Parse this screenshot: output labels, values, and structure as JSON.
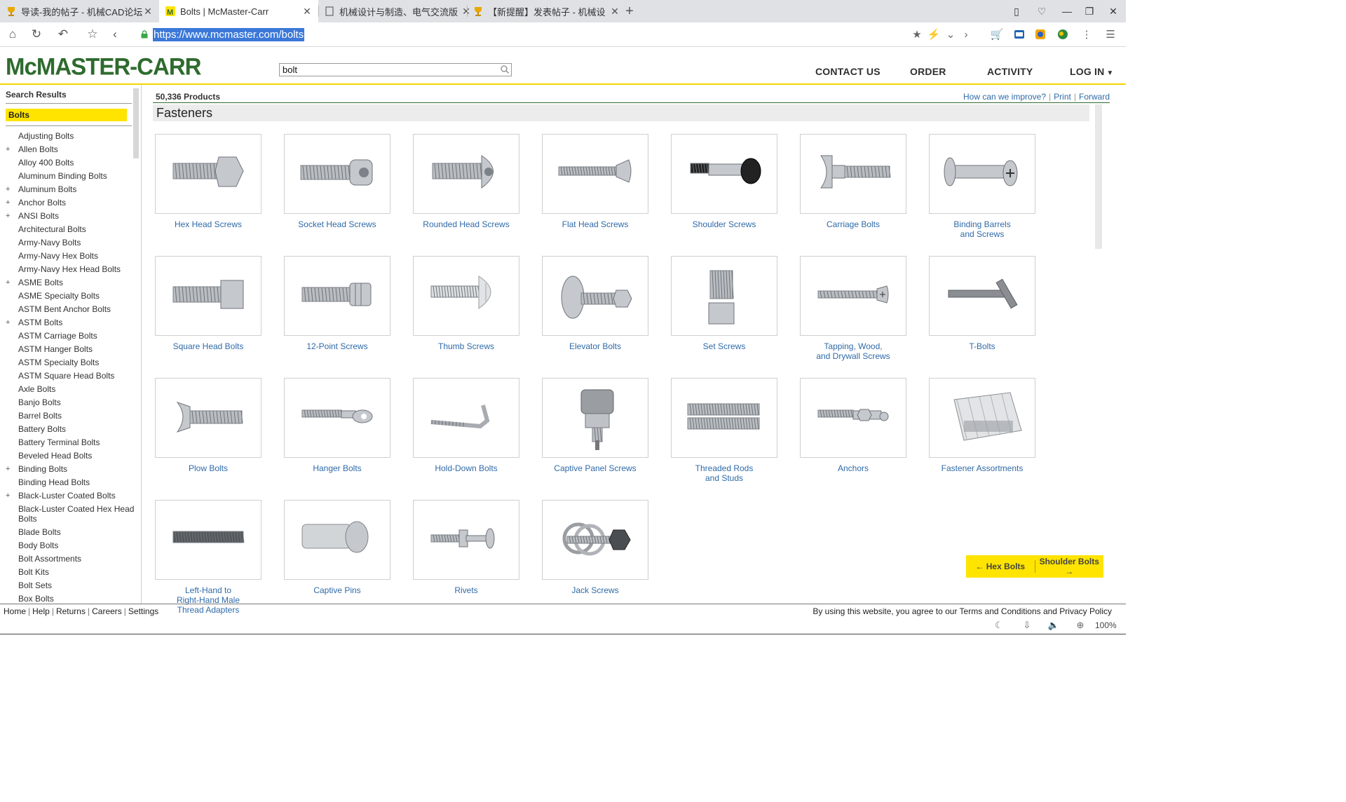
{
  "browser": {
    "tabs": [
      {
        "label": "导读-我的帖子 - 机械CAD论坛",
        "icon": "trophy-icon",
        "active": false
      },
      {
        "label": "Bolts | McMaster-Carr",
        "icon": "mcmaster-icon",
        "active": true
      },
      {
        "label": "机械设计与制造、电气交流版",
        "icon": "page-icon",
        "active": false
      },
      {
        "label": "【新提醒】发表帖子 - 机械设",
        "icon": "trophy-icon",
        "active": false
      }
    ],
    "url": "https://www.mcmaster.com/bolts",
    "zoom": "100%"
  },
  "site": {
    "logo": "McMASTER-CARR",
    "search_value": "bolt",
    "nav": [
      "CONTACT US",
      "ORDER",
      "ACTIVITY",
      "LOG IN"
    ]
  },
  "sidebar": {
    "title": "Search Results",
    "selected": "Bolts",
    "items": [
      {
        "label": "Adjusting Bolts",
        "plus": false
      },
      {
        "label": "Allen Bolts",
        "plus": true
      },
      {
        "label": "Alloy 400 Bolts",
        "plus": false
      },
      {
        "label": "Aluminum Binding Bolts",
        "plus": false
      },
      {
        "label": "Aluminum Bolts",
        "plus": true
      },
      {
        "label": "Anchor Bolts",
        "plus": true
      },
      {
        "label": "ANSI Bolts",
        "plus": true
      },
      {
        "label": "Architectural Bolts",
        "plus": false
      },
      {
        "label": "Army-Navy Bolts",
        "plus": false
      },
      {
        "label": "Army-Navy Hex Bolts",
        "plus": false
      },
      {
        "label": "Army-Navy Hex Head Bolts",
        "plus": false
      },
      {
        "label": "ASME Bolts",
        "plus": true
      },
      {
        "label": "ASME Specialty Bolts",
        "plus": false
      },
      {
        "label": "ASTM Bent Anchor Bolts",
        "plus": false
      },
      {
        "label": "ASTM Bolts",
        "plus": true
      },
      {
        "label": "ASTM Carriage Bolts",
        "plus": false
      },
      {
        "label": "ASTM Hanger Bolts",
        "plus": false
      },
      {
        "label": "ASTM Specialty Bolts",
        "plus": false
      },
      {
        "label": "ASTM Square Head Bolts",
        "plus": false
      },
      {
        "label": "Axle Bolts",
        "plus": false
      },
      {
        "label": "Banjo Bolts",
        "plus": false
      },
      {
        "label": "Barrel Bolts",
        "plus": false
      },
      {
        "label": "Battery Bolts",
        "plus": false
      },
      {
        "label": "Battery Terminal Bolts",
        "plus": false
      },
      {
        "label": "Beveled Head Bolts",
        "plus": false
      },
      {
        "label": "Binding Bolts",
        "plus": true
      },
      {
        "label": "Binding Head Bolts",
        "plus": false
      },
      {
        "label": "Black-Luster Coated Bolts",
        "plus": true
      },
      {
        "label": "Black-Luster Coated Hex Head Bolts",
        "plus": false
      },
      {
        "label": "Blade Bolts",
        "plus": false
      },
      {
        "label": "Body Bolts",
        "plus": false
      },
      {
        "label": "Bolt Assortments",
        "plus": false
      },
      {
        "label": "Bolt Kits",
        "plus": false
      },
      {
        "label": "Bolt Sets",
        "plus": false
      },
      {
        "label": "Box Bolts",
        "plus": false
      }
    ]
  },
  "main": {
    "count": "50,336 Products",
    "links": [
      "How can we improve?",
      "Print",
      "Forward"
    ],
    "category": "Fasteners",
    "products": [
      {
        "name": "Hex Head Screws",
        "shape": "hex"
      },
      {
        "name": "Socket Head Screws",
        "shape": "socket"
      },
      {
        "name": "Rounded Head Screws",
        "shape": "round"
      },
      {
        "name": "Flat Head Screws",
        "shape": "flat"
      },
      {
        "name": "Shoulder Screws",
        "shape": "shoulder"
      },
      {
        "name": "Carriage Bolts",
        "shape": "carriage"
      },
      {
        "name": "Binding Barrels\nand Screws",
        "shape": "binding"
      },
      {
        "name": "Square Head Bolts",
        "shape": "square"
      },
      {
        "name": "12-Point Screws",
        "shape": "twelve"
      },
      {
        "name": "Thumb Screws",
        "shape": "thumb"
      },
      {
        "name": "Elevator Bolts",
        "shape": "elevator"
      },
      {
        "name": "Set Screws",
        "shape": "setscrew"
      },
      {
        "name": "Tapping, Wood,\nand Drywall Screws",
        "shape": "wood"
      },
      {
        "name": "T-Bolts",
        "shape": "tbolt"
      },
      {
        "name": "Plow Bolts",
        "shape": "plow"
      },
      {
        "name": "Hanger Bolts",
        "shape": "hanger"
      },
      {
        "name": "Hold-Down Bolts",
        "shape": "hook"
      },
      {
        "name": "Captive Panel Screws",
        "shape": "captive"
      },
      {
        "name": "Threaded Rods\nand Studs",
        "shape": "rods"
      },
      {
        "name": "Anchors",
        "shape": "anchor"
      },
      {
        "name": "Fastener Assortments",
        "shape": "kit"
      },
      {
        "name": "Left-Hand to\nRight-Hand Male\nThread Adapters",
        "shape": "adapter"
      },
      {
        "name": "Captive Pins",
        "shape": "pin"
      },
      {
        "name": "Rivets",
        "shape": "rivet"
      },
      {
        "name": "Jack Screws",
        "shape": "jack"
      }
    ],
    "prev_label": "← Hex Bolts",
    "next_label": "Shoulder Bolts →"
  },
  "footer": {
    "links": [
      "Home",
      "Help",
      "Returns",
      "Careers",
      "Settings"
    ],
    "notice": "By using this website, you agree to our Terms and Conditions and Privacy Policy"
  }
}
